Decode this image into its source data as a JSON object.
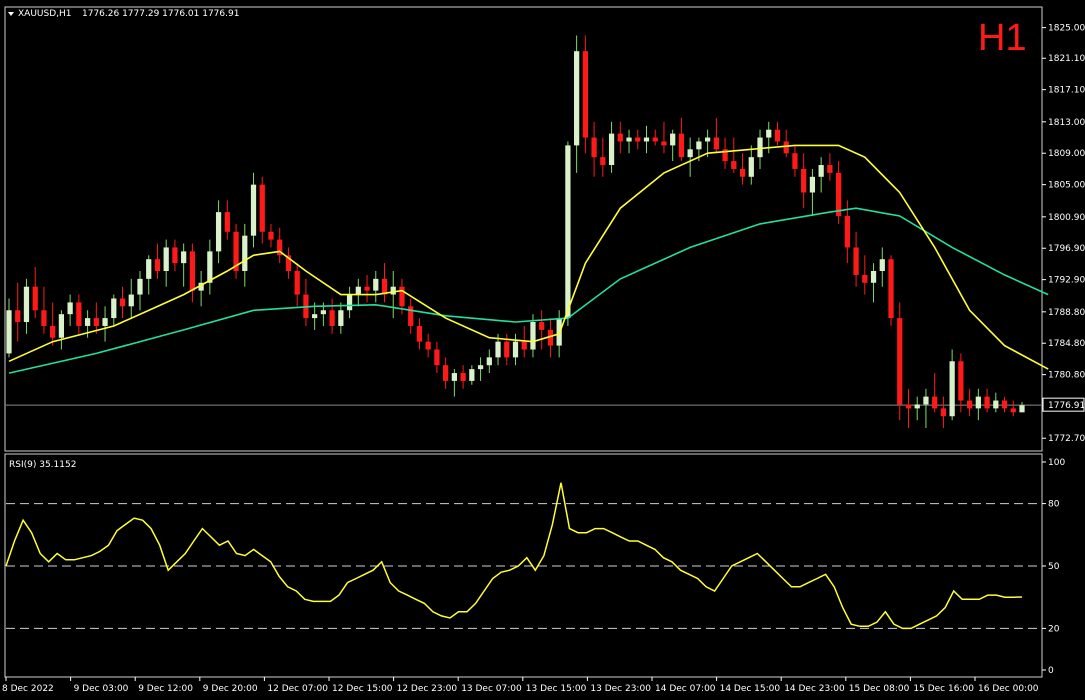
{
  "header": {
    "symbol": "XAUUSD,H1",
    "ohlc": "1776.26 1777.29 1776.01 1776.91",
    "timeframe_badge": "H1"
  },
  "rsi_header": "RSI(9) 35.1152",
  "colors": {
    "background": "#000000",
    "bull_candle": "#d9f2c9",
    "bear_candle": "#ff1a1a",
    "wick_bull": "#7fdc6a",
    "ma_fast": "#ffff33",
    "ma_slow": "#22e0a0",
    "rsi_line": "#ffff33",
    "price_line": "#8a8a8a",
    "axis_text": "#ffffff"
  },
  "chart_data": [
    {
      "type": "candlestick",
      "symbol": "XAUUSD",
      "timeframe": "H1",
      "ylim": [
        1771.2,
        1827.5
      ],
      "price_ticks": [
        "1825.00",
        "1821.10",
        "1817.10",
        "1813.00",
        "1809.00",
        "1805.00",
        "1800.90",
        "1796.90",
        "1792.90",
        "1788.80",
        "1784.80",
        "1780.80",
        "1772.70"
      ],
      "price_tick_values": [
        1825.0,
        1821.1,
        1817.1,
        1813.0,
        1809.0,
        1805.0,
        1800.9,
        1796.9,
        1792.9,
        1788.8,
        1784.8,
        1780.8,
        1772.7
      ],
      "current_price": "1776.91",
      "current_price_value": 1776.91,
      "x_labels": [
        "8 Dec 2022",
        "9 Dec 03:00",
        "9 Dec 12:00",
        "9 Dec 20:00",
        "12 Dec 07:00",
        "12 Dec 15:00",
        "12 Dec 23:00",
        "13 Dec 07:00",
        "13 Dec 15:00",
        "13 Dec 23:00",
        "14 Dec 07:00",
        "14 Dec 15:00",
        "14 Dec 23:00",
        "15 Dec 08:00",
        "15 Dec 16:00",
        "16 Dec 00:00"
      ],
      "candles": [
        [
          1783.5,
          1790.5,
          1783,
          1789
        ],
        [
          1789,
          1792.5,
          1785,
          1787.5
        ],
        [
          1787.5,
          1793,
          1786,
          1792
        ],
        [
          1792,
          1794.5,
          1788,
          1789
        ],
        [
          1789,
          1792,
          1786,
          1787
        ],
        [
          1787,
          1790,
          1784.5,
          1785.5
        ],
        [
          1785.5,
          1789,
          1784,
          1788.5
        ],
        [
          1788.5,
          1791,
          1787,
          1790
        ],
        [
          1790,
          1791,
          1786,
          1787
        ],
        [
          1787,
          1789,
          1785.5,
          1788
        ],
        [
          1788,
          1790,
          1786,
          1787
        ],
        [
          1787,
          1789.5,
          1785,
          1788
        ],
        [
          1788,
          1791,
          1787,
          1790.5
        ],
        [
          1790.5,
          1792,
          1788,
          1789.5
        ],
        [
          1789.5,
          1793,
          1788,
          1791
        ],
        [
          1791,
          1794,
          1789,
          1793
        ],
        [
          1793,
          1796,
          1791,
          1795.5
        ],
        [
          1795.5,
          1797.5,
          1793,
          1794
        ],
        [
          1794,
          1798,
          1792,
          1797
        ],
        [
          1797,
          1798,
          1794,
          1795
        ],
        [
          1795,
          1797.5,
          1792,
          1796.5
        ],
        [
          1796.5,
          1797.5,
          1790,
          1791.5
        ],
        [
          1791.5,
          1794,
          1789.5,
          1792.5
        ],
        [
          1792.5,
          1798,
          1791,
          1796.5
        ],
        [
          1796.5,
          1803,
          1795,
          1801.5
        ],
        [
          1801.5,
          1803,
          1798,
          1799
        ],
        [
          1799,
          1800,
          1793,
          1794
        ],
        [
          1794,
          1800,
          1792,
          1798.5
        ],
        [
          1798.5,
          1806.5,
          1797,
          1805
        ],
        [
          1805,
          1806,
          1797.5,
          1799
        ],
        [
          1799,
          1800,
          1797,
          1798
        ],
        [
          1798,
          1799.5,
          1795,
          1796
        ],
        [
          1796,
          1797,
          1793,
          1794
        ],
        [
          1794,
          1795,
          1789.5,
          1791
        ],
        [
          1791,
          1793,
          1787,
          1788
        ],
        [
          1788,
          1790,
          1786.5,
          1788.5
        ],
        [
          1788.5,
          1790,
          1787,
          1789
        ],
        [
          1789,
          1790.5,
          1786,
          1787
        ],
        [
          1787,
          1790,
          1786,
          1789
        ],
        [
          1789,
          1792,
          1788,
          1791
        ],
        [
          1791,
          1793,
          1789.5,
          1792
        ],
        [
          1792,
          1793.5,
          1790,
          1791.5
        ],
        [
          1791.5,
          1794,
          1790,
          1793
        ],
        [
          1793,
          1795,
          1790,
          1791
        ],
        [
          1791,
          1794,
          1788,
          1792
        ],
        [
          1792,
          1793,
          1788.5,
          1789.5
        ],
        [
          1789.5,
          1790.5,
          1786,
          1787
        ],
        [
          1787,
          1788,
          1784,
          1785
        ],
        [
          1785,
          1786,
          1783,
          1784
        ],
        [
          1784,
          1785,
          1781,
          1782
        ],
        [
          1782,
          1783,
          1779,
          1780
        ],
        [
          1780,
          1781.5,
          1778,
          1781
        ],
        [
          1781,
          1782,
          1779,
          1780
        ],
        [
          1780,
          1782,
          1779.5,
          1781.5
        ],
        [
          1781.5,
          1783,
          1780,
          1782
        ],
        [
          1782,
          1784,
          1781,
          1783
        ],
        [
          1783,
          1786,
          1782,
          1785
        ],
        [
          1785,
          1786,
          1782,
          1783
        ],
        [
          1783,
          1786,
          1782,
          1785
        ],
        [
          1785,
          1787,
          1783,
          1784
        ],
        [
          1784,
          1788.5,
          1783,
          1787.5
        ],
        [
          1787.5,
          1789,
          1784,
          1786.5
        ],
        [
          1786.5,
          1788,
          1783,
          1784.5
        ],
        [
          1784.5,
          1789,
          1783,
          1788
        ],
        [
          1788,
          1810.5,
          1787,
          1810
        ],
        [
          1810,
          1824,
          1806.5,
          1822
        ],
        [
          1822,
          1824,
          1809,
          1811
        ],
        [
          1811,
          1813,
          1806,
          1808.5
        ],
        [
          1808.5,
          1811,
          1806,
          1807.5
        ],
        [
          1807.5,
          1813,
          1806.5,
          1811.5
        ],
        [
          1811.5,
          1813,
          1809,
          1810.5
        ],
        [
          1810.5,
          1812,
          1809,
          1811
        ],
        [
          1811,
          1812,
          1809.5,
          1810.5
        ],
        [
          1810.5,
          1812.5,
          1809,
          1811
        ],
        [
          1811,
          1812,
          1810,
          1810.5
        ],
        [
          1810.5,
          1813,
          1809,
          1810
        ],
        [
          1810,
          1812,
          1808,
          1811.5
        ],
        [
          1811.5,
          1813.5,
          1808,
          1808.5
        ],
        [
          1808.5,
          1811,
          1806,
          1809.5
        ],
        [
          1809.5,
          1811,
          1808,
          1810.5
        ],
        [
          1810.5,
          1812,
          1808.5,
          1811
        ],
        [
          1811,
          1813.5,
          1809,
          1809.5
        ],
        [
          1809.5,
          1811,
          1807,
          1808
        ],
        [
          1808,
          1811,
          1806.5,
          1807
        ],
        [
          1807,
          1809,
          1805,
          1806
        ],
        [
          1806,
          1810,
          1805,
          1808.5
        ],
        [
          1808.5,
          1812,
          1807,
          1811
        ],
        [
          1811,
          1813,
          1809,
          1812
        ],
        [
          1812,
          1813,
          1810,
          1810.5
        ],
        [
          1810.5,
          1812,
          1808.5,
          1809
        ],
        [
          1809,
          1810,
          1806,
          1807
        ],
        [
          1807,
          1809,
          1802,
          1804
        ],
        [
          1804,
          1807,
          1801,
          1806
        ],
        [
          1806,
          1808.5,
          1804,
          1807.5
        ],
        [
          1807.5,
          1809,
          1805.5,
          1806.5
        ],
        [
          1806.5,
          1808,
          1800,
          1801
        ],
        [
          1801,
          1803,
          1795,
          1797
        ],
        [
          1797,
          1799,
          1792,
          1793.5
        ],
        [
          1793.5,
          1796,
          1791,
          1792.5
        ],
        [
          1792.5,
          1795,
          1790,
          1794
        ],
        [
          1794,
          1797,
          1792,
          1795.5
        ],
        [
          1795.5,
          1796,
          1787,
          1788
        ],
        [
          1788,
          1790,
          1775,
          1777
        ],
        [
          1777,
          1779,
          1774,
          1776.5
        ],
        [
          1776.5,
          1778,
          1775,
          1777
        ],
        [
          1777,
          1779,
          1774,
          1778
        ],
        [
          1778,
          1781,
          1776,
          1776.5
        ],
        [
          1776.5,
          1778,
          1774,
          1775.5
        ],
        [
          1775.5,
          1784,
          1775,
          1782.5
        ],
        [
          1782.5,
          1783.5,
          1776,
          1777.5
        ],
        [
          1777.5,
          1779,
          1775.5,
          1776.5
        ],
        [
          1776.5,
          1779,
          1775,
          1778
        ],
        [
          1778,
          1779,
          1776,
          1776.5
        ],
        [
          1776.5,
          1778.5,
          1776,
          1777.5
        ],
        [
          1777.5,
          1778,
          1776,
          1776.5
        ],
        [
          1776.5,
          1777.5,
          1775.5,
          1776
        ],
        [
          1776,
          1777.3,
          1776,
          1776.9
        ]
      ],
      "ma_fast": [
        [
          0,
          1782.5
        ],
        [
          5,
          1785
        ],
        [
          12,
          1787
        ],
        [
          20,
          1791
        ],
        [
          25,
          1794
        ],
        [
          28,
          1796
        ],
        [
          31,
          1796.5
        ],
        [
          34,
          1794
        ],
        [
          38,
          1791
        ],
        [
          42,
          1791
        ],
        [
          45,
          1791.5
        ],
        [
          50,
          1788
        ],
        [
          55,
          1785.5
        ],
        [
          60,
          1785
        ],
        [
          63,
          1786
        ],
        [
          66,
          1795
        ],
        [
          70,
          1802
        ],
        [
          75,
          1806.5
        ],
        [
          80,
          1809
        ],
        [
          85,
          1809.5
        ],
        [
          90,
          1810
        ],
        [
          95,
          1810
        ],
        [
          98,
          1808.5
        ],
        [
          102,
          1804
        ],
        [
          106,
          1797
        ],
        [
          110,
          1789
        ],
        [
          114,
          1784.5
        ],
        [
          119,
          1781.5
        ]
      ],
      "ma_slow": [
        [
          0,
          1781
        ],
        [
          10,
          1783.5
        ],
        [
          20,
          1786.5
        ],
        [
          28,
          1789
        ],
        [
          35,
          1789.5
        ],
        [
          42,
          1789.7
        ],
        [
          50,
          1788.3
        ],
        [
          58,
          1787.5
        ],
        [
          64,
          1788
        ],
        [
          70,
          1793
        ],
        [
          78,
          1797
        ],
        [
          86,
          1800
        ],
        [
          94,
          1801.5
        ],
        [
          97,
          1802
        ],
        [
          102,
          1801
        ],
        [
          108,
          1797
        ],
        [
          114,
          1793.5
        ],
        [
          119,
          1791
        ]
      ]
    },
    {
      "type": "line",
      "indicator": "RSI(9)",
      "value": 35.1152,
      "ylim": [
        0,
        100
      ],
      "y_ticks": [
        "100",
        "80",
        "50",
        "20",
        "0"
      ],
      "y_tick_values": [
        100,
        80,
        50,
        20,
        0
      ],
      "levels": [
        80,
        50,
        20
      ],
      "values": [
        50,
        62,
        72,
        66,
        56,
        52,
        56,
        53,
        53,
        54,
        55,
        57,
        60,
        67,
        70,
        73,
        72,
        68,
        60,
        48,
        52,
        56,
        62,
        68,
        64,
        60,
        62,
        56,
        55,
        58,
        55,
        52,
        45,
        40,
        38,
        34,
        33,
        33,
        33,
        36,
        42,
        44,
        46,
        48,
        52,
        42,
        38,
        36,
        34,
        32,
        28,
        26,
        25,
        28,
        28,
        32,
        38,
        44,
        47,
        48,
        50,
        54,
        48,
        55,
        70,
        90,
        68,
        66,
        66,
        68,
        68,
        66,
        64,
        62,
        62,
        60,
        58,
        54,
        52,
        48,
        46,
        44,
        40,
        38,
        44,
        50,
        52,
        54,
        56,
        52,
        48,
        44,
        40,
        40,
        42,
        44,
        46,
        40,
        30,
        22,
        21,
        21,
        23,
        28,
        22,
        20,
        20,
        22,
        24,
        26,
        30,
        38,
        34,
        34,
        34,
        36,
        36,
        35,
        35,
        35.1
      ]
    }
  ]
}
